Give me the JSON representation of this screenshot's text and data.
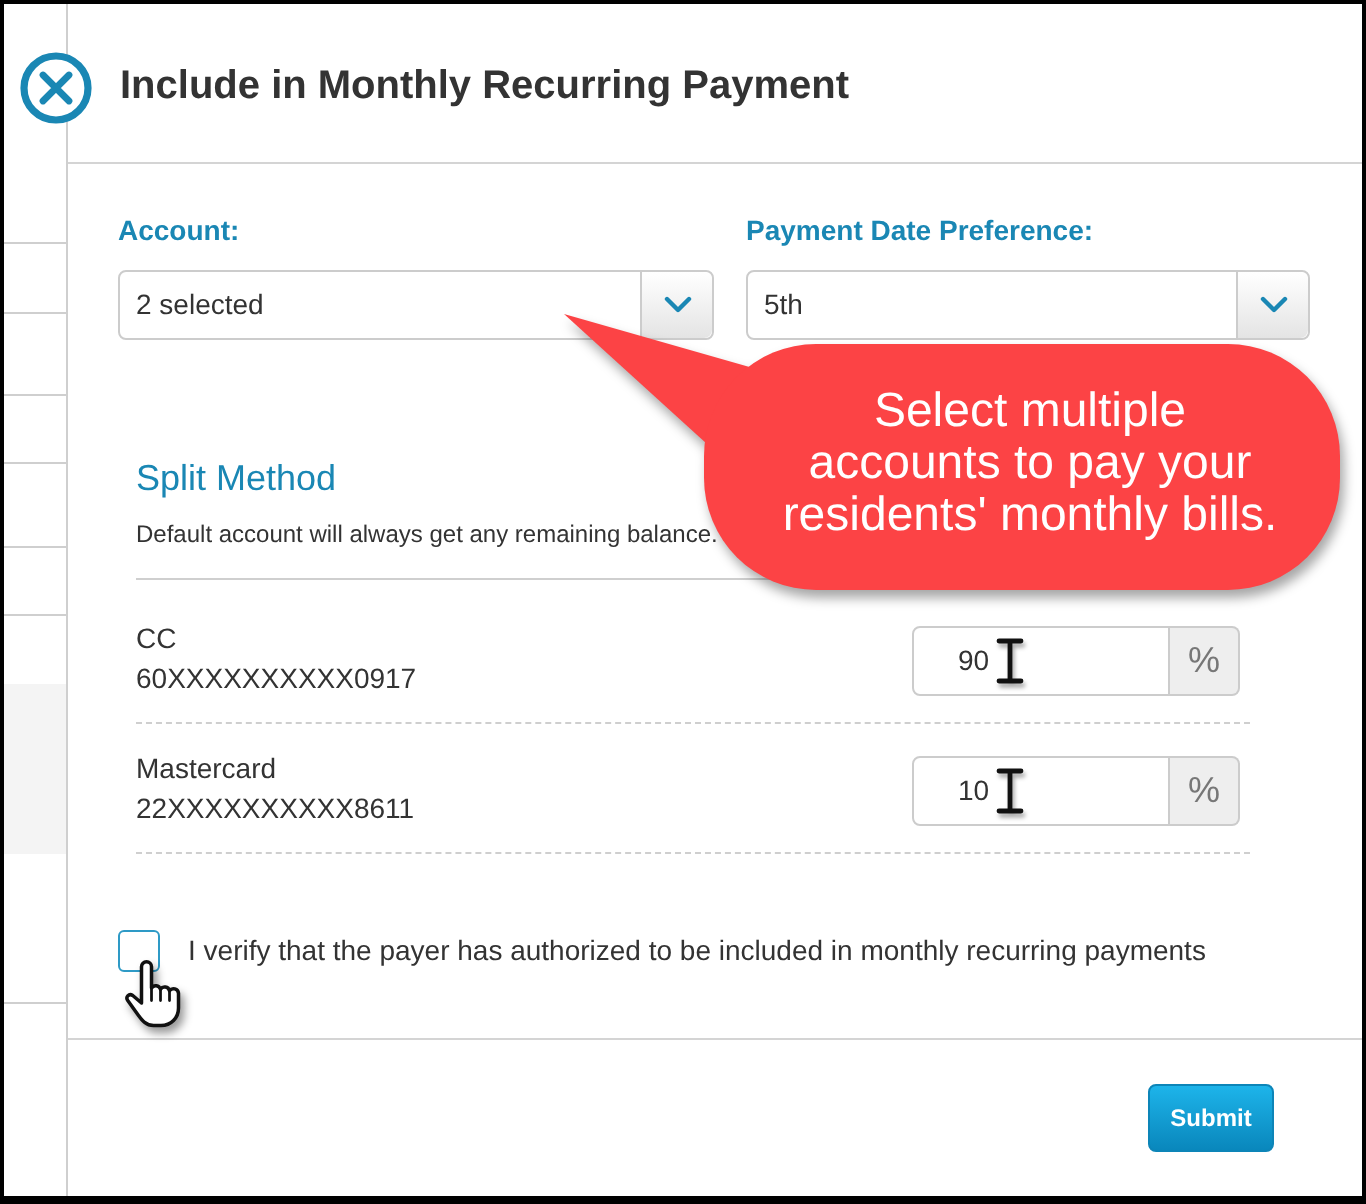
{
  "dialog": {
    "title": "Include in Monthly Recurring Payment"
  },
  "fields": [
    {
      "label": "Account:",
      "value": "2 selected"
    },
    {
      "label": "Payment Date Preference:",
      "value": "5th"
    }
  ],
  "callout": {
    "lines": [
      "Select multiple",
      "accounts to pay your",
      "residents' monthly bills."
    ]
  },
  "split_method": {
    "title": "Split Method",
    "note": "Default account will always get any remaining balance.",
    "accounts": [
      {
        "name": "CC",
        "number": "60XXXXXXXXXX0917",
        "value": "90",
        "unit": "%"
      },
      {
        "name": "Mastercard",
        "number": "22XXXXXXXXXX8611",
        "value": "10",
        "unit": "%"
      }
    ]
  },
  "verification": {
    "label": "I verify that the payer has authorized to be included in monthly recurring payments",
    "checked": false
  },
  "submit": {
    "label": "Submit"
  }
}
